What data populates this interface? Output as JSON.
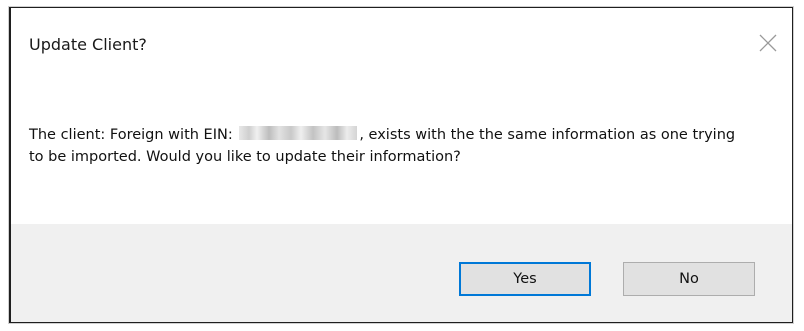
{
  "dialog": {
    "title": "Update Client?",
    "close_icon": "close-icon",
    "message_prefix": "The client: Foreign with EIN:",
    "message_suffix": ", exists with the the same information as one trying to be imported. Would you like to update their information?",
    "buttons": {
      "yes_label": "Yes",
      "no_label": "No"
    },
    "colors": {
      "default_button_border": "#0078d7",
      "footer_background": "#f0f0f0"
    }
  }
}
